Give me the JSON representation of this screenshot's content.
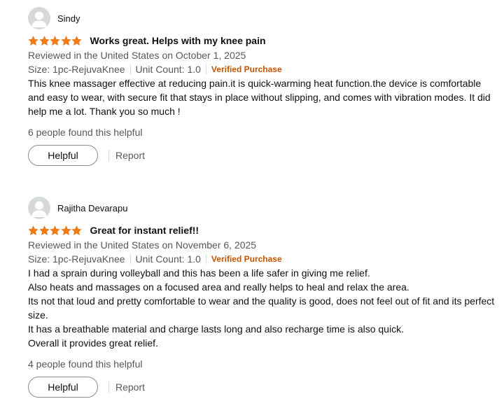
{
  "reviews": [
    {
      "author": "Sindy",
      "rating": 5,
      "title": "Works great. Helps with my knee pain",
      "reviewed_line": "Reviewed in the United States on October 1, 2025",
      "size": "Size: 1pc-RejuvaKnee",
      "unit_count": "Unit Count: 1.0",
      "verified": "Verified Purchase",
      "body": [
        "This knee massager effective at reducing pain.it is quick-warming heat function.the device is comfortable and easy to wear, with secure fit that stays in place without slipping, and comes with vibration modes. It did help me a lot. Thank you so much !"
      ],
      "helpful_count": "6 people found this helpful",
      "helpful_label": "Helpful",
      "report_label": "Report"
    },
    {
      "author": "Rajitha Devarapu",
      "rating": 5,
      "title": "Great for instant relief!!",
      "reviewed_line": "Reviewed in the United States on November 6, 2025",
      "size": "Size: 1pc-RejuvaKnee",
      "unit_count": "Unit Count: 1.0",
      "verified": "Verified Purchase",
      "body": [
        "I had a sprain during volleyball and this has been a life safer in giving me relief.",
        "Also heats and massages on a focused area and really helps to heal and relax the area.",
        "Its not that loud and pretty comfortable to wear and the quality is good, does not feel out of fit and its perfect size.",
        "It has a breathable material and charge lasts long and also recharge time is also quick.",
        "Overall it provides great relief."
      ],
      "helpful_count": "4 people found this helpful",
      "helpful_label": "Helpful",
      "report_label": "Report"
    }
  ],
  "colors": {
    "star": "#f57b14",
    "verified": "#c45500",
    "secondary_text": "#565959"
  }
}
